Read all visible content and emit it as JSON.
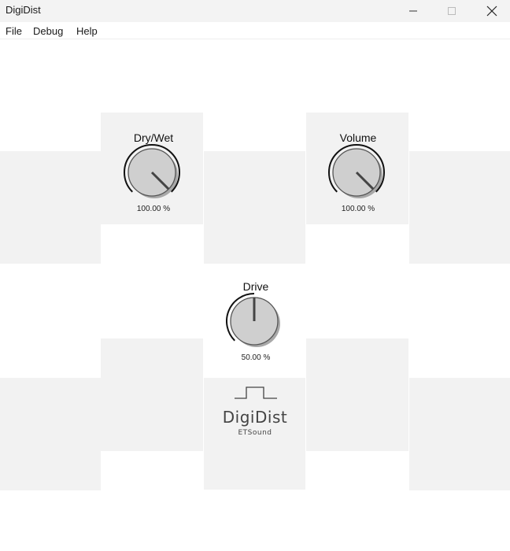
{
  "window": {
    "title": "DigiDist",
    "minimize_icon": "minimize-icon",
    "maximize_icon": "maximize-icon",
    "close_icon": "close-icon"
  },
  "menu": {
    "items": [
      {
        "label": "File"
      },
      {
        "label": "Debug"
      },
      {
        "label": "Help"
      }
    ]
  },
  "plugin": {
    "knobs": {
      "dry_wet": {
        "label": "Dry/Wet",
        "value_text": "100.00 %",
        "value": 1.0
      },
      "volume": {
        "label": "Volume",
        "value_text": "100.00 %",
        "value": 1.0
      },
      "drive": {
        "label": "Drive",
        "value_text": "50.00 %",
        "value": 0.5
      }
    },
    "logo": {
      "name": "DigiDist",
      "subtitle": "ETSound",
      "icon": "square-wave-icon"
    }
  }
}
